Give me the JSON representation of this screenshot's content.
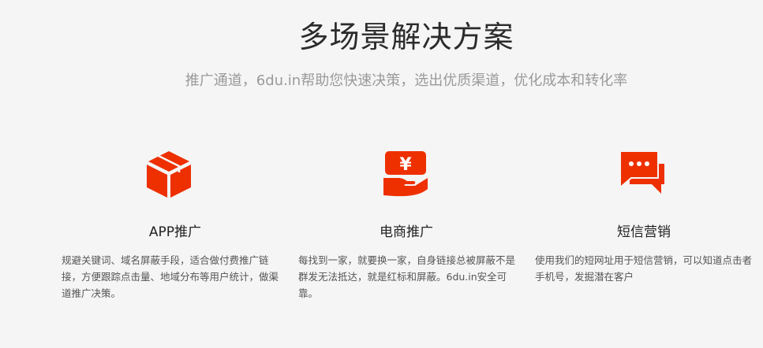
{
  "header": {
    "title": "多场景解决方案",
    "subtitle": "推广通道，6du.in帮助您快速决策，选出优质渠道，优化成本和转化率"
  },
  "colors": {
    "accent": "#ee3000",
    "background": "#f5f5f5"
  },
  "features": [
    {
      "icon": "cube-icon",
      "title": "APP推广",
      "description": "规避关键词、域名屏蔽手段，适合做付费推广链接，方便跟踪点击量、地域分布等用户统计，做渠道推广决策。"
    },
    {
      "icon": "yuan-hand-icon",
      "icon_text": "¥",
      "title": "电商推广",
      "description": "每找到一家，就要换一家，自身链接总被屏蔽不是群发无法抵达，就是红标和屏蔽。6du.in安全可靠。"
    },
    {
      "icon": "chat-bubble-icon",
      "title": "短信营销",
      "description": "使用我们的短网址用于短信营销，可以知道点击者手机号，发掘潜在客户"
    }
  ]
}
